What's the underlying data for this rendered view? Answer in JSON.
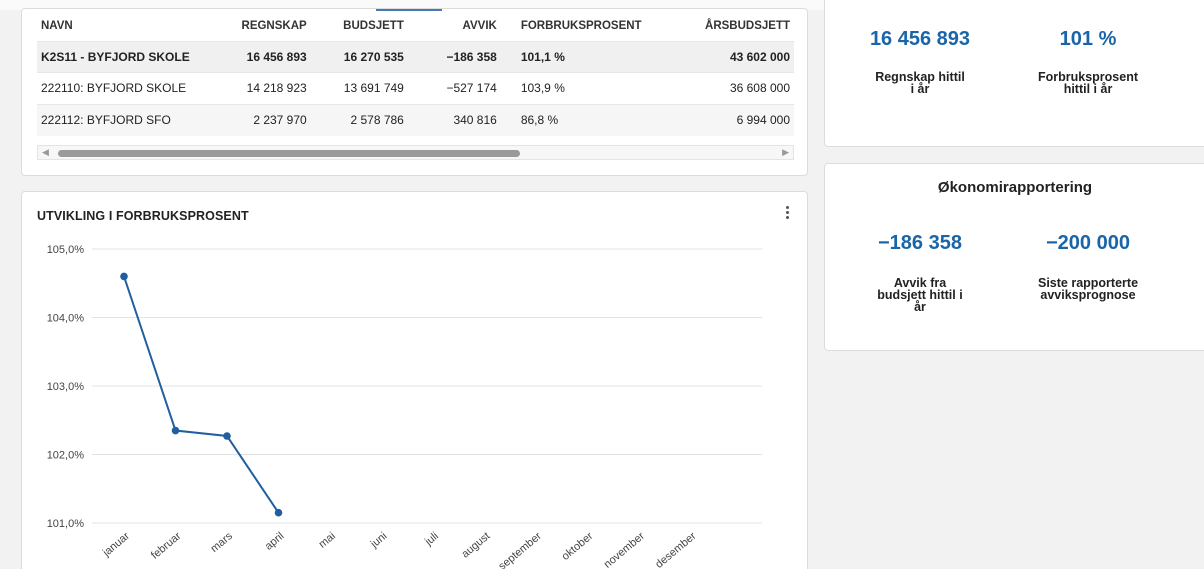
{
  "table": {
    "columns": [
      "NAVN",
      "REGNSKAP",
      "BUDSJETT",
      "AVVIK",
      "FORBRUKSPROSENT",
      "ÅRSBUDSJETT"
    ],
    "rows": [
      {
        "navn": "K2S11 - BYFJORD SKOLE",
        "regnskap": "16 456 893",
        "budsjett": "16 270 535",
        "avvik": "−186 358",
        "forbruk": "101,1 %",
        "arsbudsjett": "43 602 000"
      },
      {
        "navn": "222110: BYFJORD SKOLE",
        "regnskap": "14 218 923",
        "budsjett": "13 691 749",
        "avvik": "−527 174",
        "forbruk": "103,9 %",
        "arsbudsjett": "36 608 000"
      },
      {
        "navn": "222112: BYFJORD SFO",
        "regnskap": "2 237 970",
        "budsjett": "2 578 786",
        "avvik": "340 816",
        "forbruk": "86,8 %",
        "arsbudsjett": "6 994 000"
      }
    ]
  },
  "kpi_top": {
    "value1": "16 456 893",
    "label1": "Regnskap hittil i år",
    "value2": "101 %",
    "label2": "Forbruksprosent hittil i år"
  },
  "kpi_report": {
    "title": "Økonomirapportering",
    "value1": "−186 358",
    "label1": "Avvik fra budsjett hittil i år",
    "value2": "−200 000",
    "label2": "Siste rapporterte avviksprognose"
  },
  "chart": {
    "title": "UTVIKLING I FORBRUKSPROSENT"
  },
  "colors": {
    "accent": "#1a65a8",
    "line": "#1f5fa0"
  },
  "chart_data": {
    "type": "line",
    "categories": [
      "januar",
      "februar",
      "mars",
      "april",
      "mai",
      "juni",
      "juli",
      "august",
      "september",
      "oktober",
      "november",
      "desember"
    ],
    "series": [
      {
        "values": [
          104.6,
          102.35,
          102.27,
          101.15,
          null,
          null,
          null,
          null,
          null,
          null,
          null,
          null
        ]
      }
    ],
    "y_ticks": [
      "101,0%",
      "102,0%",
      "103,0%",
      "104,0%",
      "105,0%"
    ],
    "ylim": [
      101.0,
      105.0
    ],
    "grid": true
  }
}
